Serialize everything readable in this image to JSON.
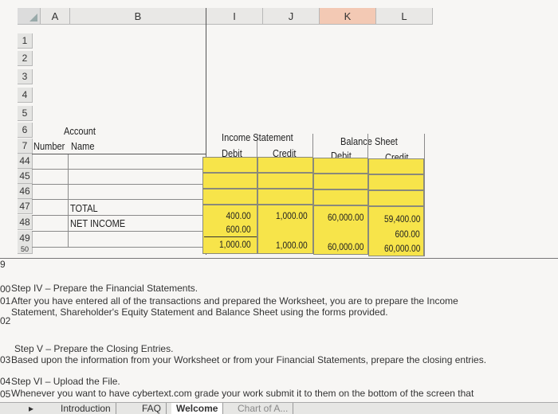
{
  "columns": [
    "A",
    "B",
    "I",
    "J",
    "K",
    "L"
  ],
  "rows": [
    "1",
    "2",
    "3",
    "4",
    "5",
    "6",
    "7",
    "44",
    "45",
    "46",
    "47",
    "48",
    "49",
    "50"
  ],
  "headers": {
    "account": "Account",
    "number": "Number",
    "name": "Name",
    "income_statement": "Income Statement",
    "balance_sheet": "Balance Sheet",
    "debit1": "Debit",
    "credit1": "Credit",
    "debit2": "Debit",
    "credit2": "Credit"
  },
  "labels": {
    "total": "TOTAL",
    "net_income": "NET INCOME"
  },
  "values": {
    "total_is_debit": "400.00",
    "total_is_credit": "1,000.00",
    "total_bs_debit": "60,000.00",
    "total_bs_credit": "59,400.00",
    "ni_is_debit": "600.00",
    "ni_bs_credit": "600.00",
    "sum_is_debit": "1,000.00",
    "sum_is_credit": "1,000.00",
    "sum_bs_debit": "60,000.00",
    "sum_bs_credit": "60,000.00"
  },
  "notes": {
    "r99": "9",
    "r100": "00",
    "r101": "01",
    "r102": "02",
    "r103": "03",
    "r104": "04",
    "r105": "05",
    "step4_title": "Step IV – Prepare the Financial Statements.",
    "step4_line1": "After you have entered all of the transactions and prepared the Worksheet, you are to prepare the Income",
    "step4_line2": "Statement, Shareholder's Equity Statement and Balance Sheet using the forms provided.",
    "step5_title": "Step V – Prepare the Closing Entries.",
    "step5_line1": "Based upon the information from your Worksheet or from your Financial Statements, prepare the closing entries.",
    "step6_title": "Step VI – Upload the File.",
    "step6_line1": "Whenever you want to have cybertext.com grade your work submit it to them on the bottom of the screen that"
  },
  "tabs": [
    "Introduction",
    "FAQ",
    "Welcome",
    "Chart of A..."
  ],
  "colors": {
    "yellow": "#f7e44a",
    "active_col": "#f3c9b4"
  }
}
